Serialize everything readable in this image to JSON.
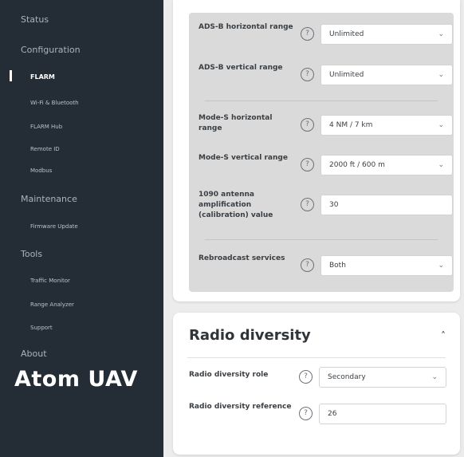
{
  "sidebar": {
    "status": "Status",
    "configuration": "Configuration",
    "config_items": [
      "FLARM",
      "Wi-Fi & Bluetooth",
      "FLARM Hub",
      "Remote ID",
      "Modbus"
    ],
    "maintenance": "Maintenance",
    "maintenance_items": [
      "Firmware Update"
    ],
    "tools": "Tools",
    "tools_items": [
      "Traffic Monitor",
      "Range Analyzer",
      "Support"
    ],
    "about": "About",
    "brand": "Atom UAV"
  },
  "settings": {
    "adsb_h": {
      "label": "ADS-B horizontal range",
      "value": "Unlimited",
      "help": "?"
    },
    "adsb_v": {
      "label": "ADS-B vertical range",
      "value": "Unlimited",
      "help": "?"
    },
    "modes_h": {
      "label": "Mode-S horizontal range",
      "value": "4 NM / 7 km",
      "help": "?"
    },
    "modes_v": {
      "label": "Mode-S vertical range",
      "value": "2000 ft / 600 m",
      "help": "?"
    },
    "amp": {
      "label": "1090 antenna amplification (calibration) value",
      "value": "30",
      "help": "?"
    },
    "rebroadcast": {
      "label": "Rebroadcast services",
      "value": "Both",
      "help": "?"
    }
  },
  "radio_diversity": {
    "title": "Radio diversity",
    "collapse_glyph": "˄",
    "role": {
      "label": "Radio diversity role",
      "value": "Secondary",
      "help": "?"
    },
    "reference": {
      "label": "Radio diversity reference",
      "value": "26",
      "help": "?"
    }
  },
  "icons": {
    "chevron": "⌄"
  }
}
